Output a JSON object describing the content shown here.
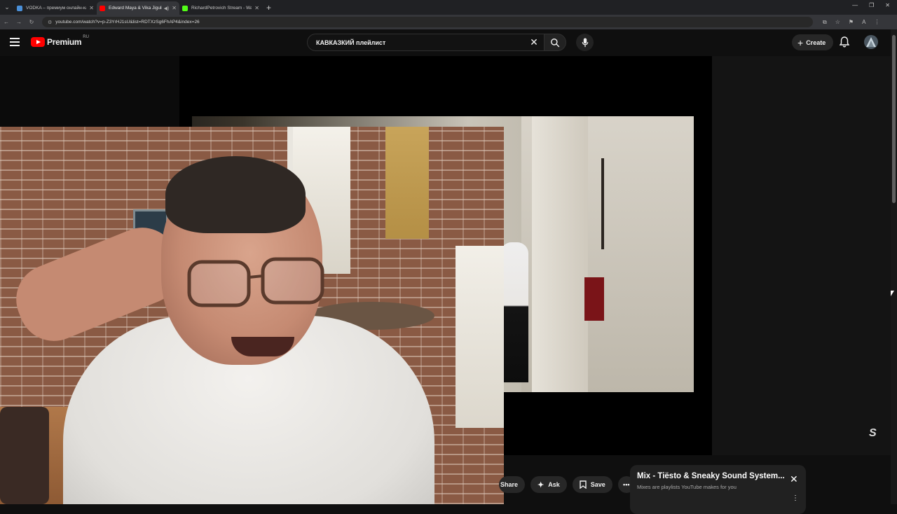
{
  "browser": {
    "tabs": [
      {
        "label": "VODKA – премиум онлайн-ка",
        "favicon_color": "#4a90d9",
        "active": false
      },
      {
        "label": "Edward Maya & Vika Jigulina",
        "favicon_color": "#ff0000",
        "active": true
      },
      {
        "label": "RichardPetrovich Stream - Wat",
        "favicon_color": "#53fc18",
        "active": false
      }
    ],
    "new_tab": "+",
    "url": "youtube.com/watch?v=p-Z3YrHJ1sU&list=RDTXzSg6FhAP4&index=26"
  },
  "header": {
    "brand": "Premium",
    "region": "RU",
    "search_query": "КАВКАЗКИЙ плейлист",
    "create_label": "Create"
  },
  "actions": {
    "share": "Share",
    "ask": "Ask",
    "save": "Save"
  },
  "mix": {
    "title": "Mix - Tiësto & Sneaky Sound System...",
    "subtitle": "Mixes are playlists YouTube makes for you"
  },
  "colors": {
    "background": "#0f0f0f",
    "accent": "#ff0000",
    "pill": "#272727"
  }
}
